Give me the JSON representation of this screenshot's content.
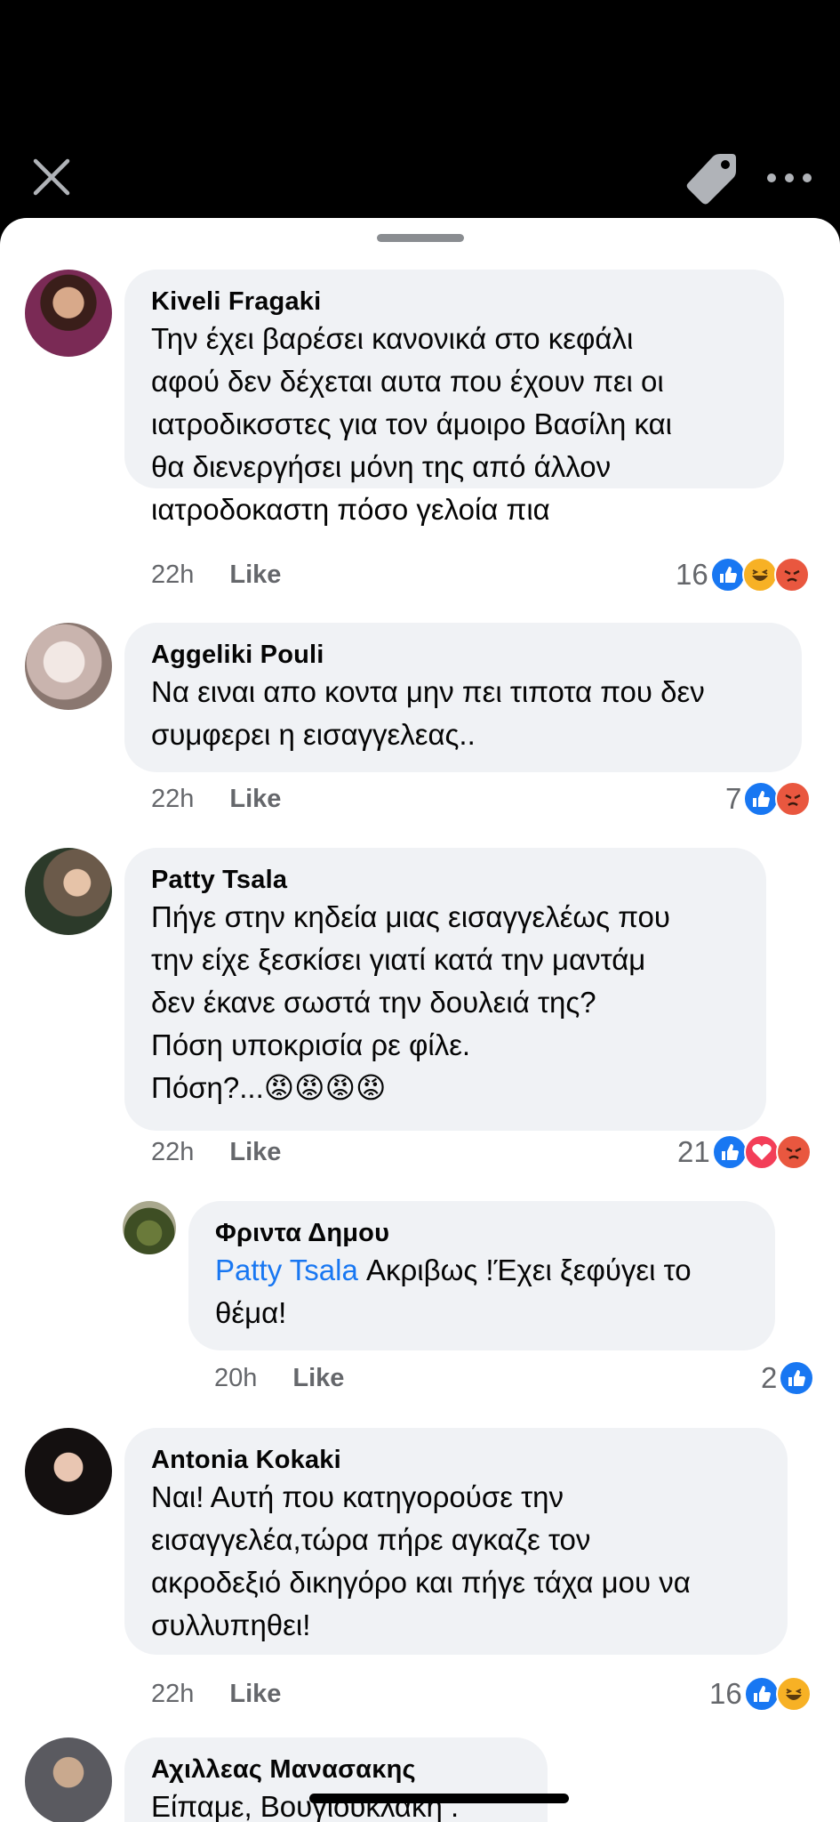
{
  "topbar": {
    "close_icon": "close-icon",
    "tag_icon": "tag-icon",
    "more_icon": "more-horizontal-icon"
  },
  "colors": {
    "like_blue": "#1877f2",
    "haha_yellow": "#f7b125",
    "angry_red": "#e9573f",
    "love_red": "#f33e58",
    "bubble_bg": "#f0f2f5",
    "meta_gray": "#65676b"
  },
  "comments": [
    {
      "author": "Kiveli Fragaki",
      "text": "Την έχει βαρέσει κανονικά στο κεφάλι\nαφού δεν δέχεται αυτα που έχουν  πει  οι\nιατροδικσστες για τον άμοιρο Βασίλη  και\nθα διενεργήσει μόνη της από άλλον\nιατροδοκαστη πόσο γελοία πια",
      "time": "22h",
      "like": "Like",
      "count": "16",
      "reactions": [
        "like",
        "haha",
        "angry"
      ]
    },
    {
      "author": "Aggeliki Pouli",
      "text": "Να ειναι απο κοντα μην πει τιποτα που δεν\nσυμφερει η εισαγγελεας..",
      "time": "22h",
      "like": "Like",
      "count": "7",
      "reactions": [
        "like",
        "angry"
      ]
    },
    {
      "author": "Patty Tsala",
      "text": "Πήγε στην κηδεία μιας εισαγγελέως που\nτην είχε ξεσκίσει γιατί κατά την  μαντάμ\nδεν έκανε σωστά την δουλειά της?\nΠόση υποκρισία ρε φίλε.\nΠόση?...",
      "emoji": "😡😡😡😡",
      "time": "22h",
      "like": "Like",
      "count": "21",
      "reactions": [
        "like",
        "love",
        "angry"
      ]
    },
    {
      "author": "Φριντα Δημου",
      "mention": "Patty Tsala",
      "text": " Ακριβως !Έχει ξεφύγει το\nθέμα!",
      "time": "20h",
      "like": "Like",
      "count": "2",
      "reactions": [
        "like"
      ]
    },
    {
      "author": "Antonia Kokaki",
      "text": "Ναι! Αυτή που κατηγορούσε την\nεισαγγελέα,τώρα πήρε αγκαζε τον\nακροδεξιό δικηγόρο και πήγε τάχα μου να\nσυλλυπηθει!",
      "time": "22h",
      "like": "Like",
      "count": "16",
      "reactions": [
        "like",
        "haha"
      ]
    },
    {
      "author": "Αχιλλεας Μανασακης",
      "text": "Είπαμε, Βουγιουκλακη ."
    }
  ]
}
